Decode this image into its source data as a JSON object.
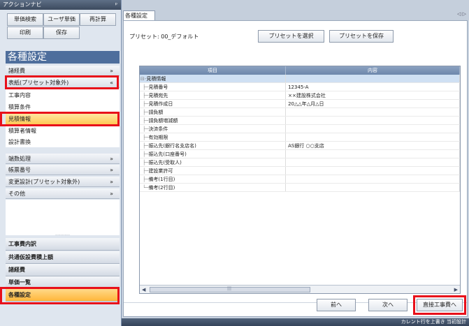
{
  "navigator": {
    "title": "アクションナビ",
    "pin": "ᵖ",
    "buttons": [
      "単価検索",
      "ユーザ単価",
      "再計算",
      "印刷",
      "保存"
    ],
    "section_header": "各種設定",
    "categories_top": [
      {
        "label": "諸経費",
        "chev": "»"
      },
      {
        "label": "表紙(プリセット対象外)",
        "chev": "«"
      }
    ],
    "sub_items": [
      "工事内容",
      "積算条件",
      "見積情報",
      "積算者情報",
      "設計書換"
    ],
    "selected_sub": "見積情報",
    "categories_bottom": [
      {
        "label": "端数処理",
        "chev": "»"
      },
      {
        "label": "帳票番号",
        "chev": "»"
      },
      {
        "label": "変更設計(プリセット対象外)",
        "chev": "»"
      },
      {
        "label": "その他",
        "chev": "»"
      }
    ],
    "dots": "···········",
    "big_items": [
      "工事費内訳",
      "共通仮設費積上額",
      "諸経費",
      "単価一覧",
      "各種設定"
    ],
    "selected_big": "各種設定"
  },
  "tab": {
    "label": "各種設定",
    "close": "⊠"
  },
  "top_right_controls": "◁ ▷",
  "preset": {
    "label": "プリセット:  00_デフォルト",
    "select_button": "プリセットを選択",
    "save_button": "プリセットを保存"
  },
  "grid": {
    "headers": [
      "項目",
      "内容"
    ],
    "group_label": "見積情報",
    "rows": [
      {
        "item": "見積番号",
        "value": "12345-A"
      },
      {
        "item": "見積宛先",
        "value": "××建設株式会社"
      },
      {
        "item": "見積作成日",
        "value": "20△△年△月△日"
      },
      {
        "item": "請負額",
        "value": ""
      },
      {
        "item": "請負額増減額",
        "value": ""
      },
      {
        "item": "決済条件",
        "value": ""
      },
      {
        "item": "有効期限",
        "value": ""
      },
      {
        "item": "振込先(銀行名支店名)",
        "value": "AS銀行  ○○支店"
      },
      {
        "item": "振込先(口座番号)",
        "value": ""
      },
      {
        "item": "振込先(受取人)",
        "value": ""
      },
      {
        "item": "建設業許可",
        "value": ""
      },
      {
        "item": "備考(1行目)",
        "value": ""
      },
      {
        "item": "備考(2行目)",
        "value": ""
      }
    ],
    "scroll_grip": "|||"
  },
  "nav_buttons": {
    "prev": "前へ",
    "next": "次へ",
    "direct": "直接工事費へ"
  },
  "status_text": "カレント行を上書き  当初設計"
}
